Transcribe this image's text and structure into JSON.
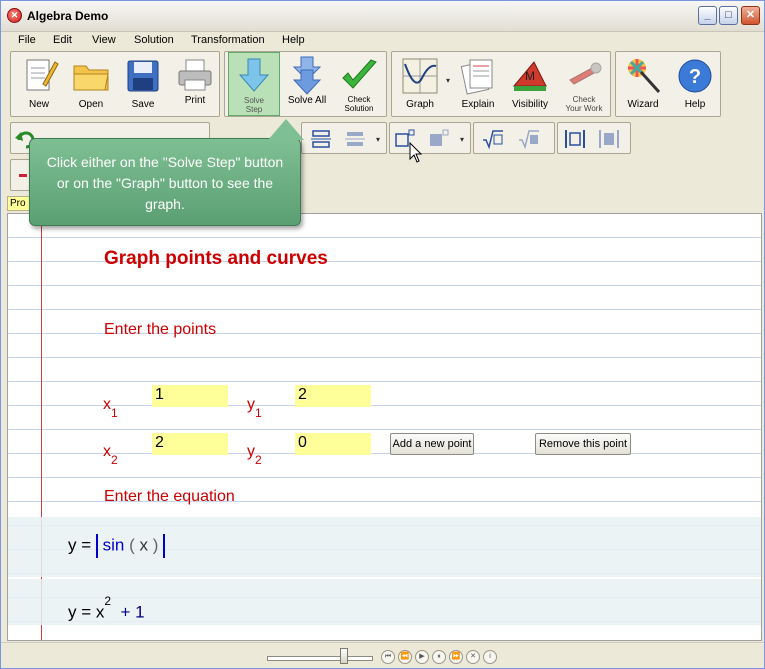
{
  "window": {
    "title": "Algebra Demo",
    "minimize": "_",
    "maximize": "□",
    "close": "✕"
  },
  "menu": [
    "File",
    "Edit",
    "View",
    "Solution",
    "Transformation",
    "Help"
  ],
  "toolbar": {
    "new": "New",
    "open": "Open",
    "save": "Save",
    "print": "Print",
    "solve_step": "Solve\nStep",
    "solve_all": "Solve All",
    "check_solution": "Check\nSolution",
    "graph": "Graph",
    "explain": "Explain",
    "visibility": "Visibility",
    "check_work": "Check\nYour Work",
    "wizard": "Wizard",
    "help": "Help",
    "visibility_letter": "M",
    "help_symbol": "?"
  },
  "tab": {
    "label": "Pro"
  },
  "callout": {
    "text": "Click either on the \"Solve Step\" button or on the \"Graph\" button to see the graph."
  },
  "notebook": {
    "heading": "Graph points and curves",
    "enter_points": "Enter the points",
    "points": [
      {
        "x_var": "x",
        "x_sub": "1",
        "x_val": "1",
        "y_var": "y",
        "y_sub": "1",
        "y_val": "2"
      },
      {
        "x_var": "x",
        "x_sub": "2",
        "x_val": "2",
        "y_var": "y",
        "y_sub": "2",
        "y_val": "0"
      }
    ],
    "add_point": "Add a new point",
    "remove_point": "Remove this point",
    "enter_equation": "Enter the equation",
    "eq1": {
      "lhs": "y =",
      "fn": "sin",
      "open": "(",
      "arg": "x",
      "close": ")"
    },
    "eq2": {
      "lhs": "y = x",
      "exp": "2",
      "rest": "+ 1"
    }
  },
  "player": [
    "⏮",
    "⏪",
    "▶",
    "⏸",
    "⏩",
    "✕",
    "i"
  ],
  "colors": {
    "accent_red": "#cc0000",
    "field_yellow": "#ffff99",
    "callout_green": "#6aae80"
  }
}
